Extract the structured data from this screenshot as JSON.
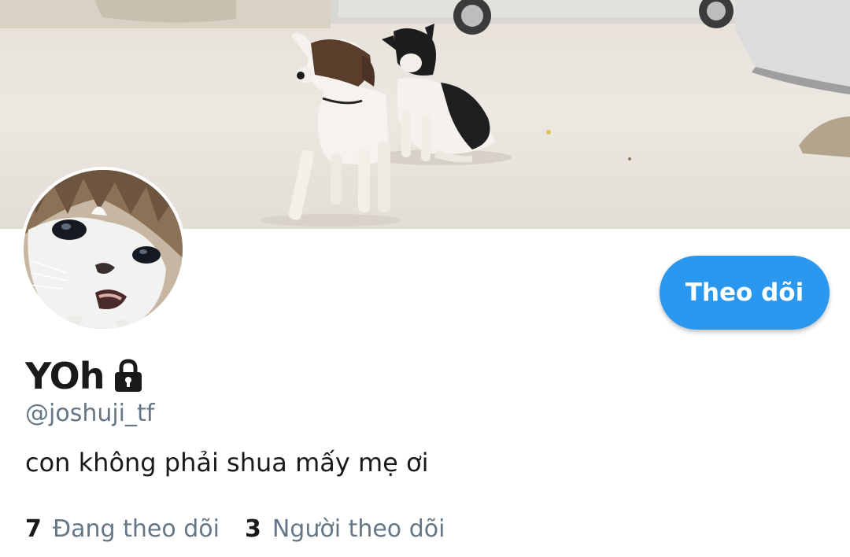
{
  "profile": {
    "display_name": "YOh",
    "handle": "@joshuji_tf",
    "bio": "con không phải shua mấy mẹ ơi",
    "protected_icon": "lock-icon",
    "banner_description_icon": "banner-image",
    "avatar_icon": "avatar-image"
  },
  "actions": {
    "follow_label": "Theo dõi"
  },
  "stats": {
    "following_count": "7",
    "following_label": "Đang theo dõi",
    "followers_count": "3",
    "followers_label": "Người theo dõi"
  },
  "colors": {
    "accent": "#2b98f0",
    "text_primary": "#1a1a1a",
    "text_secondary": "#657786"
  }
}
